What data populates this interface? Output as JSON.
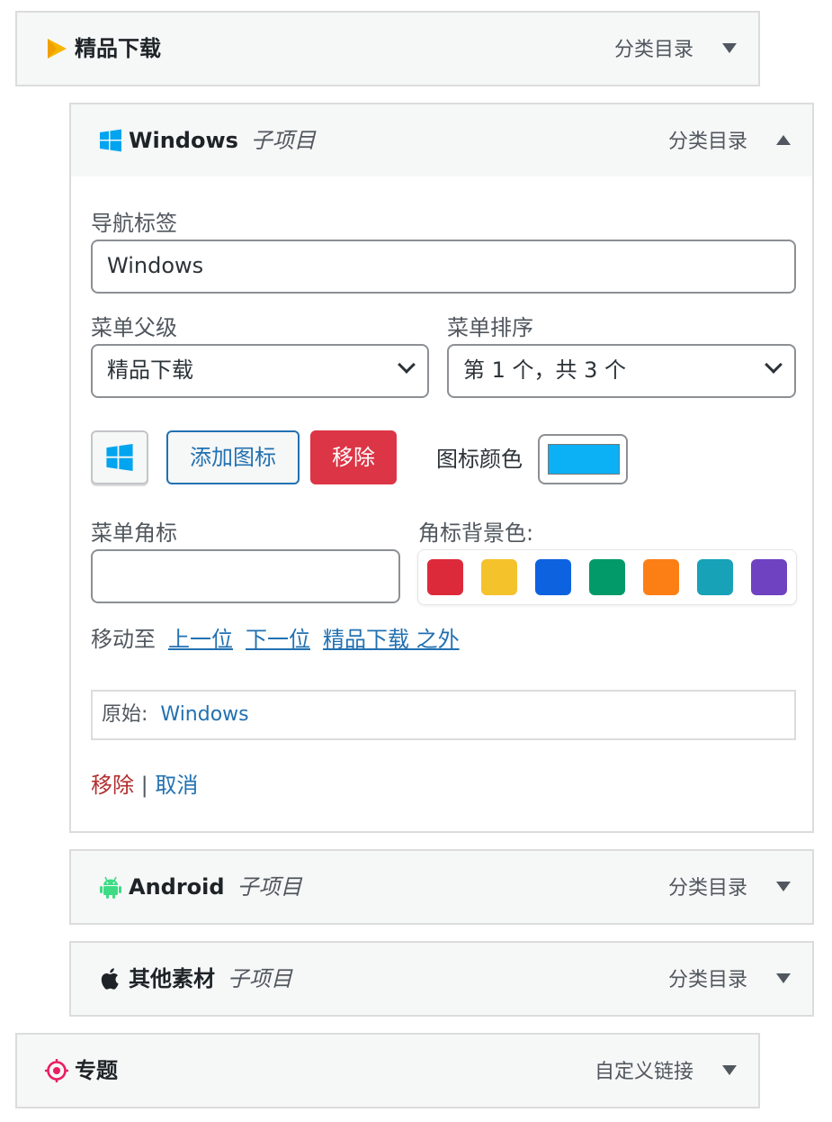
{
  "items": {
    "top": {
      "title": "精品下载",
      "type": "分类目录",
      "icon": "play-triangle-icon",
      "icon_color": "#f6b600"
    },
    "windows": {
      "title": "Windows",
      "sub": "子项目",
      "type": "分类目录",
      "icon": "windows-logo-icon",
      "icon_color": "#00a4ef"
    },
    "android": {
      "title": "Android",
      "sub": "子项目",
      "type": "分类目录",
      "icon": "android-icon",
      "icon_color": "#3ddc84"
    },
    "other": {
      "title": "其他素材",
      "sub": "子项目",
      "type": "分类目录",
      "icon": "apple-icon",
      "icon_color": "#1d2327"
    },
    "special": {
      "title": "专题",
      "type": "自定义链接",
      "icon": "target-icon",
      "icon_color": "#e91e63"
    }
  },
  "settings": {
    "nav_label": "导航标签",
    "nav_value": "Windows",
    "parent_label": "菜单父级",
    "parent_value": "精品下载",
    "order_label": "菜单排序",
    "order_value": "第 1 个，共 3 个",
    "add_icon": "添加图标",
    "remove_icon": "移除",
    "icon_color_label": "图标颜色",
    "icon_color": "#0bb0f5",
    "badge_label": "菜单角标",
    "badge_value": "",
    "badge_bg_label": "角标背景色:",
    "badge_colors": [
      "#dc2a3b",
      "#f4c22b",
      "#0d62e0",
      "#039a69",
      "#fc7f16",
      "#17a2b8",
      "#6f42c1"
    ],
    "move_label": "移动至",
    "move_up": "上一位",
    "move_down": "下一位",
    "move_out": "精品下载 之外",
    "original_label": "原始:",
    "original_value": "Windows",
    "delete": "移除",
    "separator": "|",
    "cancel": "取消"
  }
}
